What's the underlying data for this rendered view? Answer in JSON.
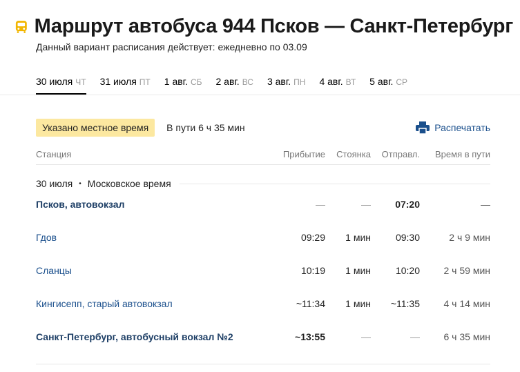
{
  "header": {
    "title": "Маршрут автобуса 944 Псков — Санкт-Петербург",
    "subtitle": "Данный вариант расписания действует: ежедневно по 03.09",
    "icon": "bus-icon",
    "accent_color": "#f2b600"
  },
  "date_tabs": [
    {
      "date": "30 июля",
      "dow": "ЧТ",
      "active": true
    },
    {
      "date": "31 июля",
      "dow": "ПТ"
    },
    {
      "date": "1 авг.",
      "dow": "СБ"
    },
    {
      "date": "2 авг.",
      "dow": "ВС"
    },
    {
      "date": "3 авг.",
      "dow": "ПН"
    },
    {
      "date": "4 авг.",
      "dow": "ВТ"
    },
    {
      "date": "5 авг.",
      "dow": "СР"
    }
  ],
  "info": {
    "local_time_badge": "Указано местное время",
    "duration": "В пути 6 ч 35 мин",
    "print_label": "Распечатать",
    "print_icon": "printer-icon",
    "badge_color": "#fce8a0",
    "link_color": "#1a4f8c"
  },
  "table": {
    "headers": {
      "station": "Станция",
      "arrival": "Прибытие",
      "stop": "Стоянка",
      "departure": "Отправл.",
      "travel_time": "Время в пути"
    },
    "day_label": "30 июля",
    "day_separator": "•",
    "timezone_label": "Московское время",
    "rows": [
      {
        "station": "Псков, автовокзал",
        "arrival": "—",
        "stop": "—",
        "departure": "07:20",
        "travel_time": "—"
      },
      {
        "station": "Гдов",
        "arrival": "09:29",
        "stop": "1 мин",
        "departure": "09:30",
        "travel_time": "2 ч 9 мин"
      },
      {
        "station": "Сланцы",
        "arrival": "10:19",
        "stop": "1 мин",
        "departure": "10:20",
        "travel_time": "2 ч 59 мин"
      },
      {
        "station": "Кингисепп, старый автовокзал",
        "arrival": "~11:34",
        "stop": "1 мин",
        "departure": "~11:35",
        "travel_time": "4 ч 14 мин"
      },
      {
        "station": "Санкт-Петербург, автобусный вокзал №2",
        "arrival": "~13:55",
        "stop": "—",
        "departure": "—",
        "travel_time": "6 ч 35 мин"
      }
    ]
  }
}
